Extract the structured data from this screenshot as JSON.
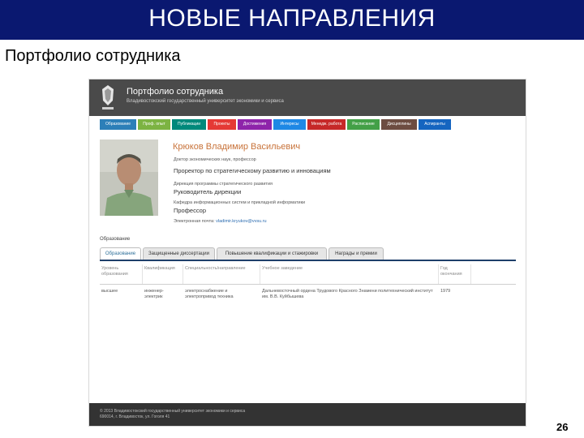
{
  "slide": {
    "title": "НОВЫЕ НАПРАВЛЕНИЯ",
    "subtitle": "Портфолио сотрудника",
    "page_number": "26"
  },
  "site": {
    "title": "Портфолио сотрудника",
    "subtitle": "Владивостокский государственный университет экономики и сервиса"
  },
  "nav": [
    {
      "label": "Образование",
      "color": "#2c7fb8"
    },
    {
      "label": "Проф. опыт",
      "color": "#7cb342"
    },
    {
      "label": "Публикации",
      "color": "#00897b"
    },
    {
      "label": "Проекты",
      "color": "#e53935"
    },
    {
      "label": "Достижения",
      "color": "#8e24aa"
    },
    {
      "label": "Интересы",
      "color": "#1e88e5"
    },
    {
      "label": "Менедж. работа",
      "color": "#c62828"
    },
    {
      "label": "Расписание",
      "color": "#43a047"
    },
    {
      "label": "Дисциплины",
      "color": "#6d4c41"
    },
    {
      "label": "Аспиранты",
      "color": "#1565c0"
    }
  ],
  "profile": {
    "name": "Крюков Владимир Васильевич",
    "degree": "Доктор экономических наук, профессор",
    "position1": "Проректор по стратегическому развитию и инновациям",
    "dept1": "Дирекция программы стратегического развития",
    "position2": "Руководитель дирекции",
    "dept2": "Кафедра информационных систем и прикладной информатики",
    "position3": "Профессор",
    "email_label": "Электронная почта:",
    "email": "vladimir.kryukov@vvsu.ru"
  },
  "education": {
    "section_label": "Образование",
    "tabs": [
      "Образование",
      "Защищенные диссертации",
      "Повышение квалификации и стажировки",
      "Награды и премии"
    ],
    "columns": [
      "Уровень образования",
      "Квалификация",
      "Специальность/направление",
      "Учебное заведение",
      "Год окончания"
    ],
    "rows": [
      [
        "высшее",
        "инженер-электрик",
        "электроснабжение и электропривод техника",
        "Дальневосточный ордена Трудового Красного Знамени политехнический институт им. В.В. Куйбышева",
        "1979"
      ]
    ]
  },
  "footer": {
    "line1": "© 2013 Владивостокский государственный университет экономики и сервиса",
    "line2": "690014, г. Владивосток, ул. Гоголя 41"
  }
}
